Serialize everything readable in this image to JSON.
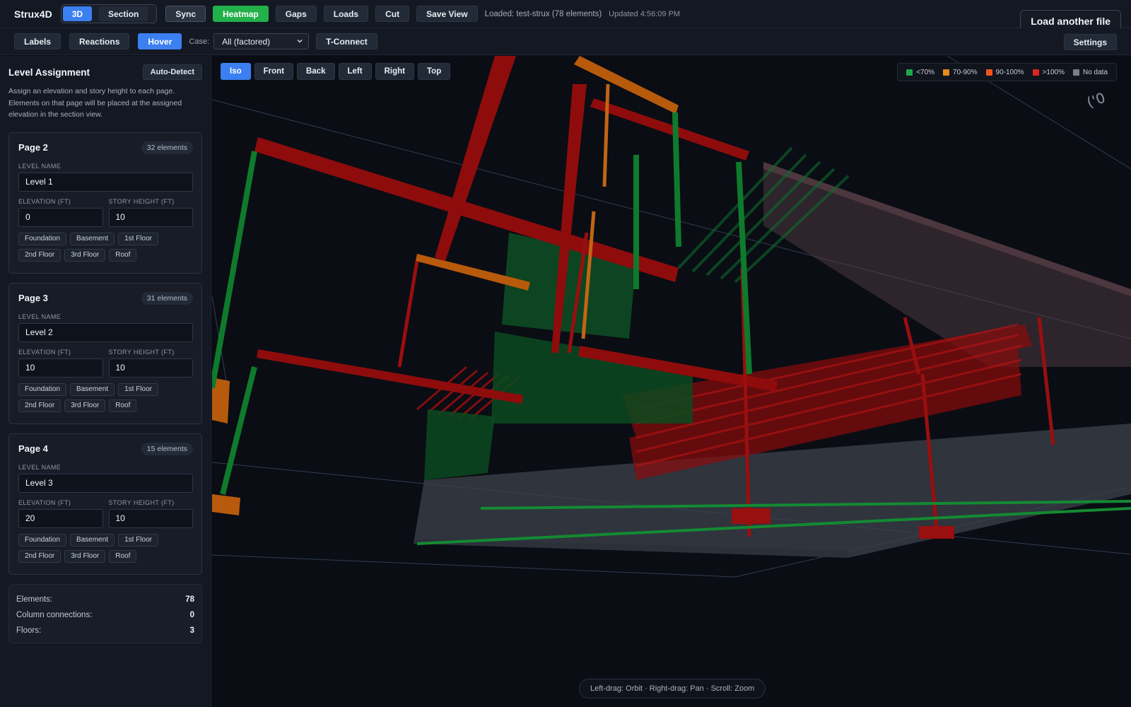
{
  "topbar": {
    "app_title": "Strux4D",
    "mode_3d": "3D",
    "mode_section": "Section",
    "sync": "Sync",
    "heatmap": "Heatmap",
    "gaps": "Gaps",
    "loads": "Loads",
    "cut": "Cut",
    "save_view": "Save View",
    "loaded_status": "Loaded: test-strux (78 elements)",
    "updated_status": "Updated 4:56:09 PM",
    "load_another": "Load another file"
  },
  "subbar": {
    "labels": "Labels",
    "reactions": "Reactions",
    "hover": "Hover",
    "case_label": "Case:",
    "case_value": "All (factored)",
    "t_connect": "T-Connect",
    "settings": "Settings"
  },
  "sidebar": {
    "title": "Level Assignment",
    "auto_detect": "Auto-Detect",
    "description": "Assign an elevation and story height to each page. Elements on that page will be placed at the assigned elevation in the section view.",
    "field_level_name": "LEVEL NAME",
    "field_elevation": "ELEVATION (FT)",
    "field_story_height": "STORY HEIGHT (FT)",
    "chips": [
      "Foundation",
      "Basement",
      "1st Floor",
      "2nd Floor",
      "3rd Floor",
      "Roof"
    ],
    "pages": [
      {
        "title": "Page 2",
        "count": "32 elements",
        "level_name": "Level 1",
        "elevation": "0",
        "story_height": "10"
      },
      {
        "title": "Page 3",
        "count": "31 elements",
        "level_name": "Level 2",
        "elevation": "10",
        "story_height": "10"
      },
      {
        "title": "Page 4",
        "count": "15 elements",
        "level_name": "Level 3",
        "elevation": "20",
        "story_height": "10"
      }
    ],
    "stats": [
      {
        "label": "Elements:",
        "value": "78"
      },
      {
        "label": "Column connections:",
        "value": "0"
      },
      {
        "label": "Floors:",
        "value": "3"
      }
    ]
  },
  "viewport": {
    "view_buttons": [
      "Iso",
      "Front",
      "Back",
      "Left",
      "Right",
      "Top"
    ],
    "active_view": "Iso",
    "legend": [
      {
        "label": "<70%",
        "color": "#1fa64a"
      },
      {
        "label": "70-90%",
        "color": "#e68a1a"
      },
      {
        "label": "90-100%",
        "color": "#f0561c"
      },
      {
        "label": ">100%",
        "color": "#e02424"
      },
      {
        "label": "No data",
        "color": "#7a7f88"
      }
    ],
    "hint": "Left-drag: Orbit · Right-drag: Pan · Scroll: Zoom",
    "corner_text": "('0"
  }
}
